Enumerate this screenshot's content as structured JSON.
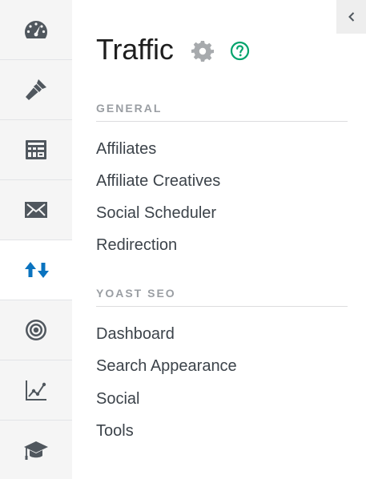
{
  "rail": {
    "items": [
      {
        "icon": "dashboard-gauge-icon"
      },
      {
        "icon": "paintbrush-icon"
      },
      {
        "icon": "layout-grid-icon"
      },
      {
        "icon": "envelope-icon"
      },
      {
        "icon": "traffic-arrows-icon",
        "active": true
      },
      {
        "icon": "target-icon"
      },
      {
        "icon": "line-chart-icon"
      },
      {
        "icon": "graduation-cap-icon"
      }
    ],
    "active_color": "#0a73bf",
    "icon_color": "#50575e"
  },
  "header": {
    "title": "Traffic",
    "settings_icon": "gear-icon",
    "help_icon": "help-circle-icon",
    "help_color": "#00a36c",
    "collapse_icon": "chevron-left-icon"
  },
  "sections": [
    {
      "heading": "GENERAL",
      "links": [
        "Affiliates",
        "Affiliate Creatives",
        "Social Scheduler",
        "Redirection"
      ]
    },
    {
      "heading": "YOAST SEO",
      "links": [
        "Dashboard",
        "Search Appearance",
        "Social",
        "Tools"
      ]
    }
  ]
}
